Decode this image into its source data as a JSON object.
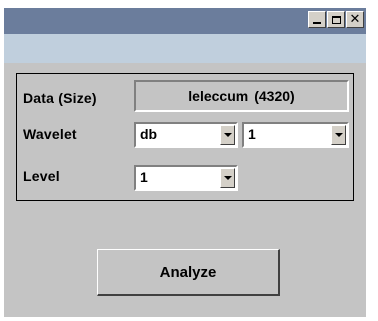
{
  "window": {
    "title": "",
    "controls": {
      "minimize_icon": "minimize-icon",
      "maximize_icon": "maximize-icon",
      "close_glyph": "✕"
    },
    "colors": {
      "titlebar": "#6b7d9c",
      "menu_strip": "#c0cfdd",
      "client": "#c4c4c4"
    }
  },
  "form": {
    "data_size": {
      "label": "Data  (Size)",
      "signal": "leleccum",
      "size": "(4320)"
    },
    "wavelet": {
      "label": "Wavelet",
      "family": "db",
      "order": "1"
    },
    "level": {
      "label": "Level",
      "value": "1"
    }
  },
  "actions": {
    "analyze_label": "Analyze"
  }
}
